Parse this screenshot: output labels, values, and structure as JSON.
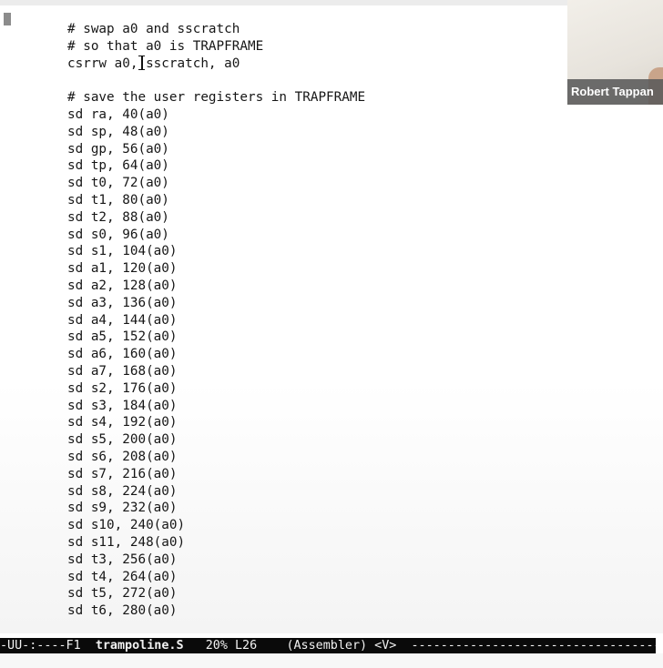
{
  "editor": {
    "code_lines": [
      "# swap a0 and sscratch",
      "# so that a0 is TRAPFRAME",
      "csrrw a0, sscratch, a0",
      "",
      "# save the user registers in TRAPFRAME",
      "sd ra, 40(a0)",
      "sd sp, 48(a0)",
      "sd gp, 56(a0)",
      "sd tp, 64(a0)",
      "sd t0, 72(a0)",
      "sd t1, 80(a0)",
      "sd t2, 88(a0)",
      "sd s0, 96(a0)",
      "sd s1, 104(a0)",
      "sd a1, 120(a0)",
      "sd a2, 128(a0)",
      "sd a3, 136(a0)",
      "sd a4, 144(a0)",
      "sd a5, 152(a0)",
      "sd a6, 160(a0)",
      "sd a7, 168(a0)",
      "sd s2, 176(a0)",
      "sd s3, 184(a0)",
      "sd s4, 192(a0)",
      "sd s5, 200(a0)",
      "sd s6, 208(a0)",
      "sd s7, 216(a0)",
      "sd s8, 224(a0)",
      "sd s9, 232(a0)",
      "sd s10, 240(a0)",
      "sd s11, 248(a0)",
      "sd t3, 256(a0)",
      "sd t4, 264(a0)",
      "sd t5, 272(a0)",
      "sd t6, 280(a0)"
    ]
  },
  "mode_line": {
    "status": "-UU-:----F1  ",
    "buffer_name": "trampoline.S",
    "position": "   20% L26    ",
    "major_mode": "(Assembler) <V>",
    "fill": "  -------------------------------------------"
  },
  "webcam": {
    "name": "Robert Tappan"
  }
}
